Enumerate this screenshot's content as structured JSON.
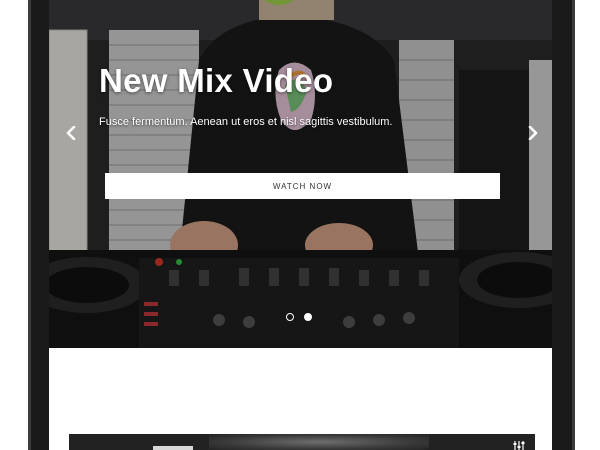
{
  "hero": {
    "title": "New Mix Video",
    "subtitle": "Fusce fermentum. Aenean ut eros et nisl sagittis vestibulum.",
    "button_label": "WATCH NOW",
    "slides_total": 2,
    "active_slide": 2
  },
  "icons": {
    "prev": "chevron-left-icon",
    "next": "chevron-right-icon",
    "card": "mixer-sliders-icon"
  },
  "colors": {
    "device_frame": "#1a1a1a",
    "hero_overlay": "#2b2b2b",
    "button_bg": "#ffffff",
    "button_text": "#333333",
    "page_bg": "#ffffff"
  }
}
